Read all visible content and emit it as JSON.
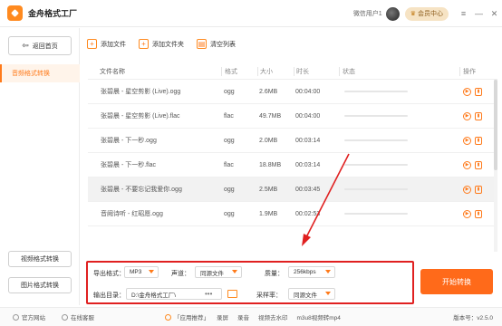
{
  "app": {
    "title": "金舟格式工厂"
  },
  "user": {
    "name": "微信用户1",
    "vip_label": "会员中心"
  },
  "window_controls": {
    "menu": "≡",
    "minimize": "—",
    "close": "✕"
  },
  "sidebar": {
    "back_label": "返回首页",
    "active_item": "音频格式转换",
    "video_label": "视频格式转换",
    "image_label": "图片格式转换"
  },
  "toolbar": {
    "add_file": "添加文件",
    "add_folder": "添加文件夹",
    "clear_list": "清空列表"
  },
  "table": {
    "headers": {
      "name": "文件名称",
      "format": "格式",
      "size": "大小",
      "duration": "时长",
      "status": "状态",
      "actions": "操作"
    },
    "rows": [
      {
        "name": "张碧晨 - 星空剪影 (Live).ogg",
        "format": "ogg",
        "size": "2.6MB",
        "duration": "00:04:00"
      },
      {
        "name": "张碧晨 - 星空剪影 (Live).flac",
        "format": "flac",
        "size": "49.7MB",
        "duration": "00:04:00"
      },
      {
        "name": "张碧晨 - 下一秒.ogg",
        "format": "ogg",
        "size": "2.0MB",
        "duration": "00:03:14"
      },
      {
        "name": "张碧晨 - 下一秒.flac",
        "format": "flac",
        "size": "18.8MB",
        "duration": "00:03:14"
      },
      {
        "name": "张碧晨 - 不要忘记我爱你.ogg",
        "format": "ogg",
        "size": "2.5MB",
        "duration": "00:03:45"
      },
      {
        "name": "音阙诗听 - 红昭愿.ogg",
        "format": "ogg",
        "size": "1.9MB",
        "duration": "00:02:53"
      }
    ]
  },
  "settings": {
    "output_format_label": "导出格式：",
    "output_format_value": "MP3",
    "channel_label": "声道：",
    "channel_value": "同源文件",
    "quality_label": "质量：",
    "quality_value": "256kbps",
    "output_dir_label": "输出目录：",
    "output_dir_value": "D:\\金舟格式工厂\\",
    "dir_more": "•••",
    "sample_rate_label": "采样率：",
    "sample_rate_value": "同源文件"
  },
  "start_button": "开始转换",
  "bottombar": {
    "website": "官方网站",
    "support": "在线客服",
    "recommend": "「应用推荐」",
    "apps": [
      "录屏",
      "录音",
      "视频去水印",
      "m3u8视频转mp4"
    ],
    "version": "版本号：v2.5.0"
  },
  "colors": {
    "accent": "#ff6a1a",
    "highlight_box": "#e02020"
  }
}
